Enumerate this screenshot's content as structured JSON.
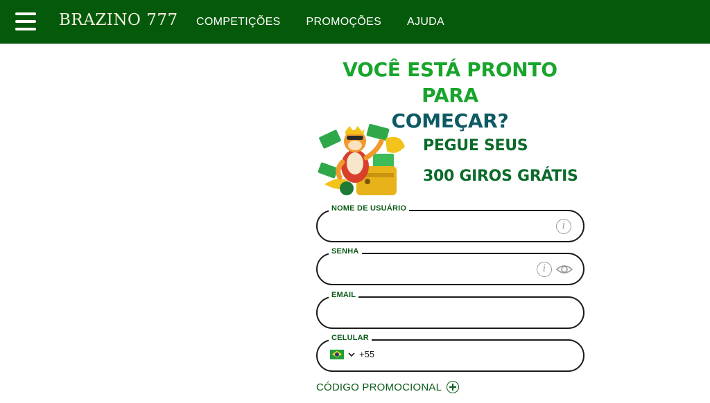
{
  "header": {
    "logo": "BRAZINO 777",
    "nav": [
      "COMPETIÇÕES",
      "PROMOÇÕES",
      "AJUDA"
    ],
    "background": "#045a0a"
  },
  "headline": {
    "line1": "VOCÊ ESTÁ PRONTO PARA",
    "line2": "COMEÇAR?"
  },
  "promo": {
    "line1": "PEGUE SEUS",
    "line2": "300 GIROS GRÁTIS"
  },
  "form": {
    "username_label": "NOME DE USUÁRIO",
    "password_label": "SENHA",
    "email_label": "EMAIL",
    "phone_label": "CELULAR",
    "phone_dial_code": "+55",
    "promo_code_label": "CÓDIGO PROMOCIONAL"
  },
  "icons": {
    "menu": "hamburger-icon",
    "info": "info-icon",
    "eye": "eye-icon",
    "flag": "brazil-flag-icon",
    "chevron": "chevron-down-icon",
    "plus": "plus-circle-icon"
  },
  "colors": {
    "accent_green": "#18a52c",
    "headline_teal": "#0d5a63",
    "promo_green": "#0b6a2a"
  }
}
